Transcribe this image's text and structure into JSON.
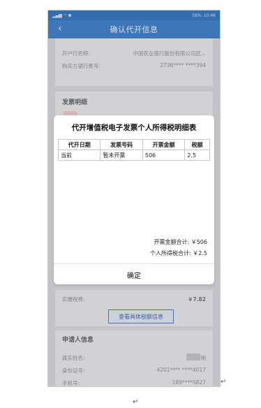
{
  "status": {
    "time": "10:46",
    "battery": "58%"
  },
  "header": {
    "title": "确认代开信息",
    "back_icon": "chevron-left-icon"
  },
  "top_info": [
    {
      "label": "开户行名称:",
      "value": "中国农业银行股份有限公司武..."
    },
    {
      "label": "购买方银行账号:",
      "value": "2736**** ****394"
    }
  ],
  "invoice_section": {
    "title": "发票明细"
  },
  "dialog": {
    "title": "代开增值税电子发票个人所得税明细表",
    "columns": [
      "代开日期",
      "发票号码",
      "开票金额",
      "税额"
    ],
    "rows": [
      [
        "当前",
        "暂未开票",
        "506",
        "2.5"
      ]
    ],
    "total_amount_label": "开票金额合计: ￥506",
    "total_tax_label": "个人所得税合计: ￥2.5",
    "confirm_label": "确定"
  },
  "summary": {
    "label": "实缴税费:",
    "value": "￥7.82"
  },
  "view_tax_button": "查看具体税额信息",
  "applicant": {
    "title": "申请人信息",
    "items": [
      {
        "label": "真实姓名:",
        "value": "明"
      },
      {
        "label": "身份证号:",
        "value": "4201**** ****4017"
      },
      {
        "label": "手机号:",
        "value": "189****5827"
      }
    ]
  },
  "marks": {
    "return_mark": "↵"
  }
}
